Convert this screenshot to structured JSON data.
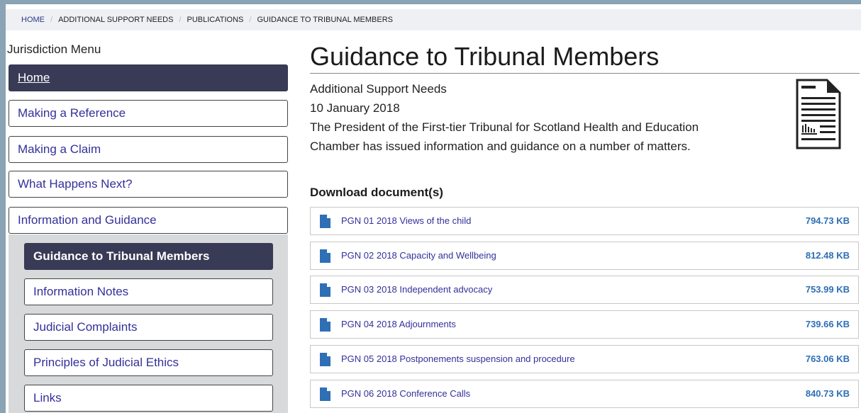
{
  "breadcrumb": {
    "items": [
      "HOME",
      "ADDITIONAL SUPPORT NEEDS",
      "PUBLICATIONS",
      "GUIDANCE TO TRIBUNAL MEMBERS"
    ]
  },
  "sidebar": {
    "title": "Jurisdiction Menu",
    "items": [
      {
        "label": "Home"
      },
      {
        "label": "Making a Reference"
      },
      {
        "label": "Making a Claim"
      },
      {
        "label": "What Happens Next?"
      },
      {
        "label": "Information and Guidance"
      }
    ],
    "subitems": [
      {
        "label": "Guidance to Tribunal Members"
      },
      {
        "label": "Information Notes"
      },
      {
        "label": "Judicial Complaints"
      },
      {
        "label": "Principles of Judicial Ethics"
      },
      {
        "label": "Links"
      }
    ]
  },
  "main": {
    "title": "Guidance to Tribunal Members",
    "category": "Additional Support Needs",
    "date": "10 January 2018",
    "description_line1": "The President of the First-tier Tribunal for Scotland Health and Education",
    "description_line2": "Chamber has issued information and guidance on a number of matters.",
    "download_heading": "Download document(s)",
    "documents": [
      {
        "name": "PGN 01 2018 Views of the child",
        "size": "794.73 KB"
      },
      {
        "name": "PGN 02 2018 Capacity and Wellbeing",
        "size": "812.48 KB"
      },
      {
        "name": "PGN 03 2018 Independent advocacy",
        "size": "753.99 KB"
      },
      {
        "name": "PGN 04 2018 Adjournments",
        "size": "739.66 KB"
      },
      {
        "name": "PGN 05 2018 Postponements suspension and procedure",
        "size": "763.06 KB"
      },
      {
        "name": "PGN 06 2018 Conference Calls",
        "size": "840.73 KB"
      }
    ]
  },
  "icons": {
    "document_large": "document-icon",
    "file": "file-icon"
  },
  "colors": {
    "active_menu_bg": "#393a55",
    "link": "#33309a",
    "file_size": "#2e6fb5",
    "file_icon": "#2e6fb5"
  }
}
